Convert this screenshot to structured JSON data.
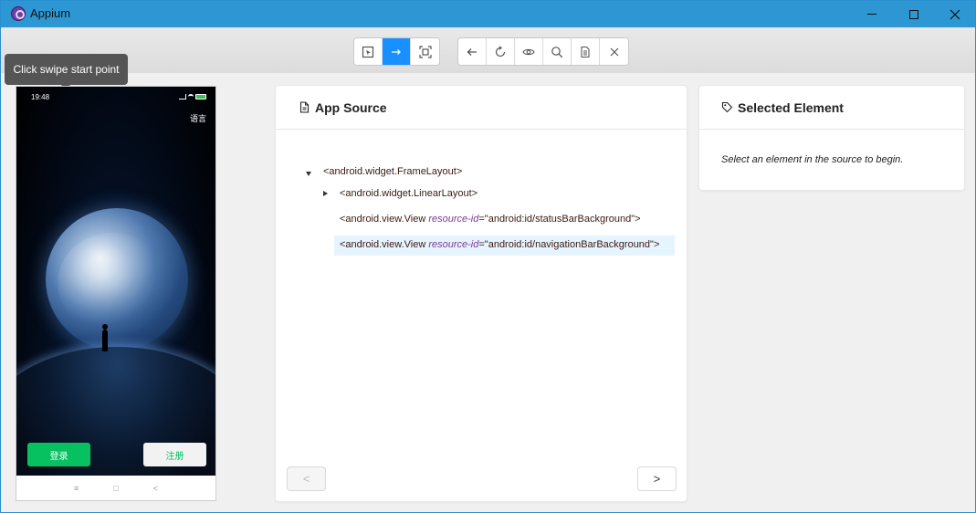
{
  "window": {
    "title": "Appium"
  },
  "toolbar": {
    "group_a": [
      {
        "icon": "select-elements-icon",
        "active": false
      },
      {
        "icon": "swipe-arrow-icon",
        "active": true
      },
      {
        "icon": "tap-coordinates-icon",
        "active": false
      }
    ],
    "group_b": [
      {
        "icon": "back-arrow-icon"
      },
      {
        "icon": "refresh-icon"
      },
      {
        "icon": "eye-icon"
      },
      {
        "icon": "search-icon"
      },
      {
        "icon": "copy-xml-icon"
      },
      {
        "icon": "close-icon"
      }
    ],
    "active_color": "#1890ff"
  },
  "tooltip": {
    "text": "Click swipe start point"
  },
  "device": {
    "time": "19:48",
    "language_label": "语言",
    "login_label": "登录",
    "register_label": "注册",
    "nav_buttons": [
      "≡",
      "□",
      "<"
    ],
    "accent": "#07c160"
  },
  "source": {
    "title": "App Source",
    "nodes": [
      {
        "tag": "<android.widget.FrameLayout>",
        "attr": "",
        "value": "",
        "expand": "down"
      },
      {
        "tag": "<android.widget.LinearLayout>",
        "attr": "",
        "value": "",
        "expand": "right"
      },
      {
        "tag": "<android.view.View ",
        "attr": "resource-id",
        "value": "=\"android:id/statusBarBackground\">",
        "expand": ""
      },
      {
        "tag": "<android.view.View ",
        "attr": "resource-id",
        "value": "=\"android:id/navigationBarBackground\">",
        "expand": ""
      }
    ],
    "prev": "<",
    "next": ">"
  },
  "selected": {
    "title": "Selected Element",
    "hint": "Select an element in the source to begin."
  }
}
